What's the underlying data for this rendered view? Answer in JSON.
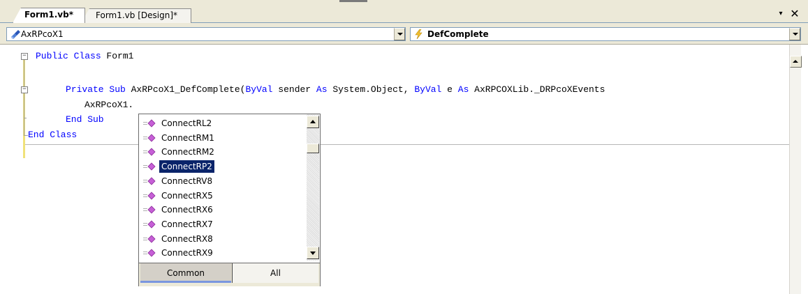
{
  "tabs": [
    {
      "label": "Form1.vb*",
      "active": true
    },
    {
      "label": "Form1.vb [Design]*",
      "active": false
    }
  ],
  "tabstrip": {
    "dropdown_glyph": "▾",
    "close_glyph": "✕"
  },
  "navbar": {
    "class_combo": {
      "value": "AxRPcoX1",
      "icon": "control-icon"
    },
    "method_combo": {
      "value": "DefComplete",
      "icon": "lightning-event-icon"
    }
  },
  "code": {
    "line1": {
      "kw": "Public Class",
      "rest": " Form1"
    },
    "line3": {
      "kw1": "Private Sub",
      "rest1": " AxRPcoX1_DefComplete(",
      "kw2": "ByVal",
      "rest2": " sender ",
      "kw3": "As",
      "rest3": " System.Object, ",
      "kw4": "ByVal",
      "rest4": " e ",
      "kw5": "As",
      "rest5": " AxRPCOXLib._DRPcoXEvents"
    },
    "line4": {
      "text": "AxRPcoX1."
    },
    "line5": {
      "kw": "End Sub"
    },
    "line6": {
      "kw": "End Class"
    }
  },
  "intellisense": {
    "items": [
      {
        "label": "ConnectRL2",
        "icon": "method-icon",
        "selected": false
      },
      {
        "label": "ConnectRM1",
        "icon": "method-icon",
        "selected": false
      },
      {
        "label": "ConnectRM2",
        "icon": "method-icon",
        "selected": false
      },
      {
        "label": "ConnectRP2",
        "icon": "method-icon",
        "selected": true
      },
      {
        "label": "ConnectRV8",
        "icon": "method-icon",
        "selected": false
      },
      {
        "label": "ConnectRX5",
        "icon": "method-icon",
        "selected": false
      },
      {
        "label": "ConnectRX6",
        "icon": "method-icon",
        "selected": false
      },
      {
        "label": "ConnectRX7",
        "icon": "method-icon",
        "selected": false
      },
      {
        "label": "ConnectRX8",
        "icon": "method-icon",
        "selected": false
      },
      {
        "label": "ConnectRX9",
        "icon": "method-icon",
        "selected": false
      }
    ],
    "filter_tabs": {
      "common": "Common",
      "all": "All",
      "active": "common"
    }
  },
  "colors": {
    "keyword": "#0000ff",
    "selection": "#0a246a",
    "chrome": "#ece9d8"
  }
}
